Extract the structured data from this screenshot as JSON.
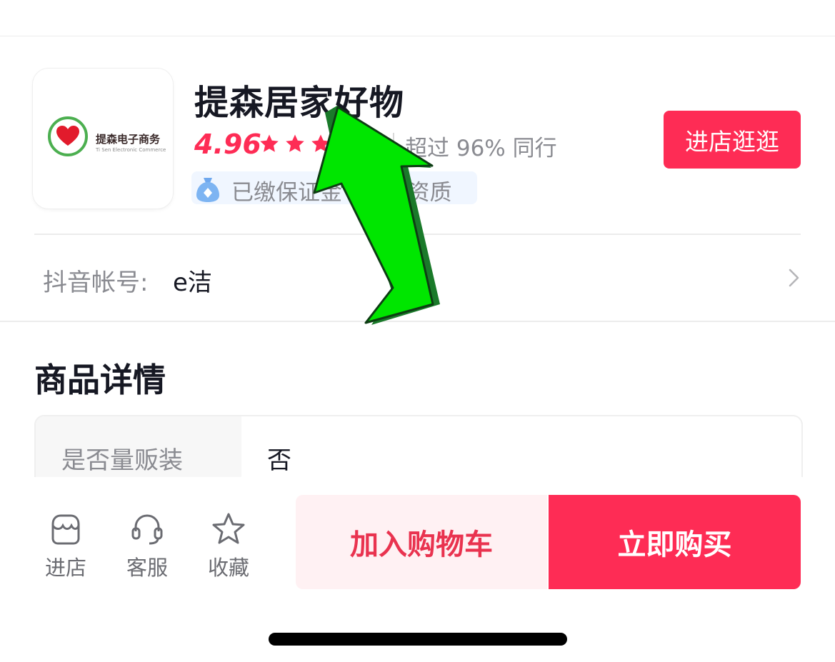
{
  "shop": {
    "logo_text": "提森电子商务",
    "logo_subtext": "Ti Sen Electronic Commerce",
    "name": "提森居家好物",
    "rating": "4.96",
    "star_count": 5,
    "rank_text": "超过 96% 同行",
    "badge_text": "已缴保证金 · 商家资质",
    "enter_button": "进店逛逛"
  },
  "account": {
    "label": "抖音帐号:",
    "value": "e洁"
  },
  "details": {
    "title": "商品详情",
    "rows": [
      {
        "key": "是否量贩装",
        "value": "否"
      }
    ]
  },
  "bottom_bar": {
    "actions": [
      {
        "label": "进店",
        "icon": "store-icon"
      },
      {
        "label": "客服",
        "icon": "headset-icon"
      },
      {
        "label": "收藏",
        "icon": "star-outline-icon"
      }
    ],
    "add_to_cart": "加入购物车",
    "buy_now": "立即购买"
  },
  "colors": {
    "accent": "#fe2c55",
    "annotation_arrow": "#00e600"
  }
}
